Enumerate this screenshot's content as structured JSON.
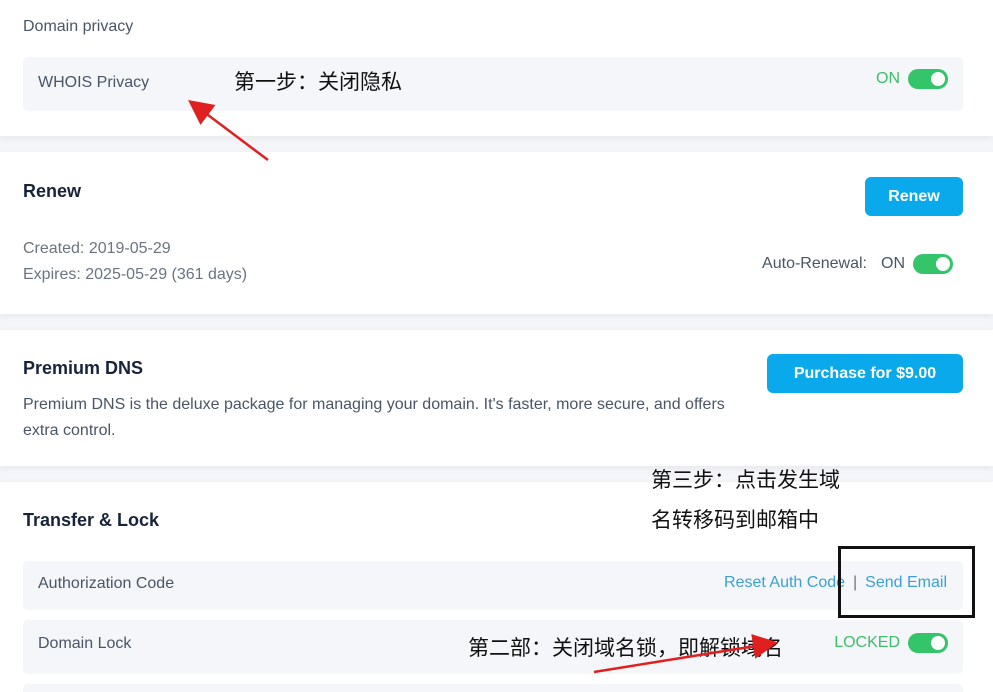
{
  "privacy": {
    "section_label": "Domain privacy",
    "whois_label": "WHOIS Privacy",
    "whois_state": "ON"
  },
  "renew": {
    "title": "Renew",
    "button": "Renew",
    "created": "Created: 2019-05-29",
    "expires": "Expires: 2025-05-29 (361 days)",
    "auto_label": "Auto-Renewal:",
    "auto_state": "ON"
  },
  "dns": {
    "title": "Premium DNS",
    "description": "Premium DNS is the deluxe package for managing your domain. It's faster, more secure, and offers extra control.",
    "button": "Purchase for $9.00"
  },
  "transfer": {
    "title": "Transfer & Lock",
    "auth_label": "Authorization Code",
    "reset_link": "Reset Auth Code",
    "separator": "|",
    "send_link": "Send Email",
    "lock_label": "Domain Lock",
    "lock_state": "LOCKED"
  },
  "annotations": {
    "step1": "第一步：关闭隐私",
    "step3_line1": "第三步：点击发生域",
    "step3_line2": "名转移码到邮箱中",
    "step2": "第二部：关闭域名锁，即解锁域名"
  },
  "colors": {
    "accent": "#0aa9ec",
    "toggle_on": "#34c46a",
    "link": "#3aa1d6",
    "annotation_arrow": "#e02020"
  }
}
